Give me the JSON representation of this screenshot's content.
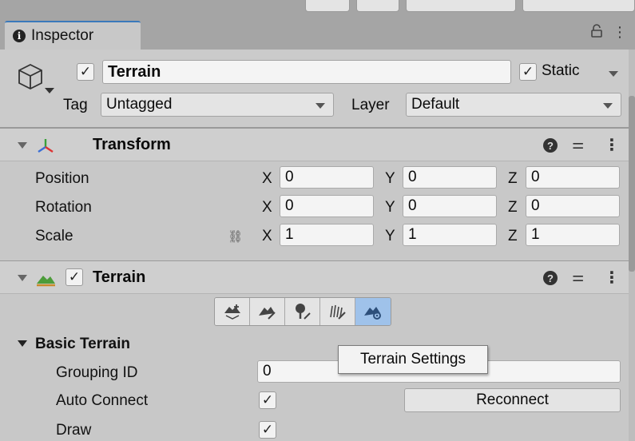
{
  "tab": {
    "label": "Inspector"
  },
  "object": {
    "name": "Terrain",
    "active_checked": "✓",
    "static_label": "Static",
    "static_checked": "✓",
    "tag_label": "Tag",
    "tag_value": "Untagged",
    "layer_label": "Layer",
    "layer_value": "Default"
  },
  "transform": {
    "title": "Transform",
    "rows": [
      {
        "label": "Position",
        "x": "0",
        "y": "0",
        "z": "0"
      },
      {
        "label": "Rotation",
        "x": "0",
        "y": "0",
        "z": "0"
      },
      {
        "label": "Scale",
        "x": "1",
        "y": "1",
        "z": "1"
      }
    ],
    "axis_x": "X",
    "axis_y": "Y",
    "axis_z": "Z"
  },
  "terrain": {
    "title": "Terrain",
    "enabled_checked": "✓",
    "tools": [
      "create-neighbor-terrains-tool",
      "paint-terrain-tool",
      "paint-trees-tool",
      "paint-details-tool",
      "terrain-settings-tool"
    ],
    "selected_tool_index": 4,
    "tooltip": "Terrain Settings",
    "section_title": "Basic Terrain",
    "grouping_id_label": "Grouping ID",
    "grouping_id_value": "0",
    "auto_connect_label": "Auto Connect",
    "auto_connect_checked": "✓",
    "reconnect_label": "Reconnect",
    "draw_label": "Draw",
    "draw_checked": "✓"
  },
  "colors": {
    "accent_tab": "#3a79bb",
    "selected_tool": "#9fc2ea",
    "panel_bg": "#c8c8c8"
  }
}
